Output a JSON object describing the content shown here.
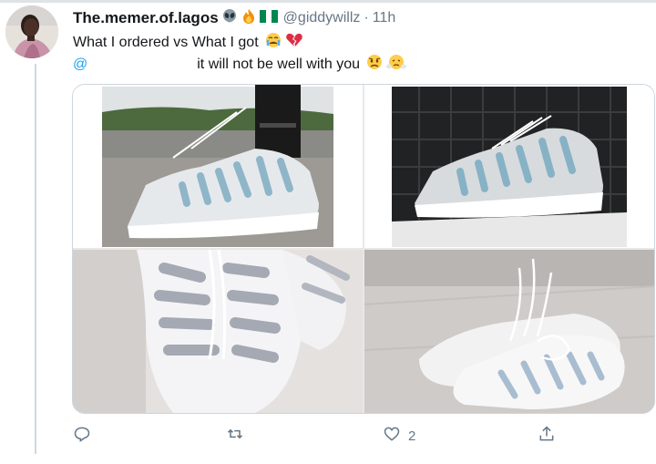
{
  "tweet": {
    "display_name": "The.memer.of.lagos",
    "name_emojis": [
      "alien-emoji",
      "fire-emoji",
      "nigeria-flag-emoji"
    ],
    "handle": "@giddywillz",
    "separator": "·",
    "time": "11h",
    "text_line1": "What I ordered vs What I got",
    "text_line1_emojis": [
      "crying-face-emoji",
      "broken-heart-emoji"
    ],
    "mention_prefix": "@",
    "text_line2": "it will not be well with you",
    "text_line2_emojis": [
      "frowning-face-emoji",
      "face-with-steam-emoji"
    ],
    "media": [
      {
        "name": "ordered-shoe-worn-photo"
      },
      {
        "name": "ordered-shoe-studio-photo"
      },
      {
        "name": "received-shoe-closeup-photo"
      },
      {
        "name": "received-shoe-pair-photo"
      }
    ],
    "actions": {
      "reply_icon": "reply-icon",
      "retweet_icon": "retweet-icon",
      "like_icon": "heart-icon",
      "like_count": "2",
      "share_icon": "share-icon"
    }
  },
  "colors": {
    "link": "#1da1f2",
    "secondary_text": "#657786",
    "thread_line": "#cfd9de",
    "border": "#ccd6dd"
  }
}
